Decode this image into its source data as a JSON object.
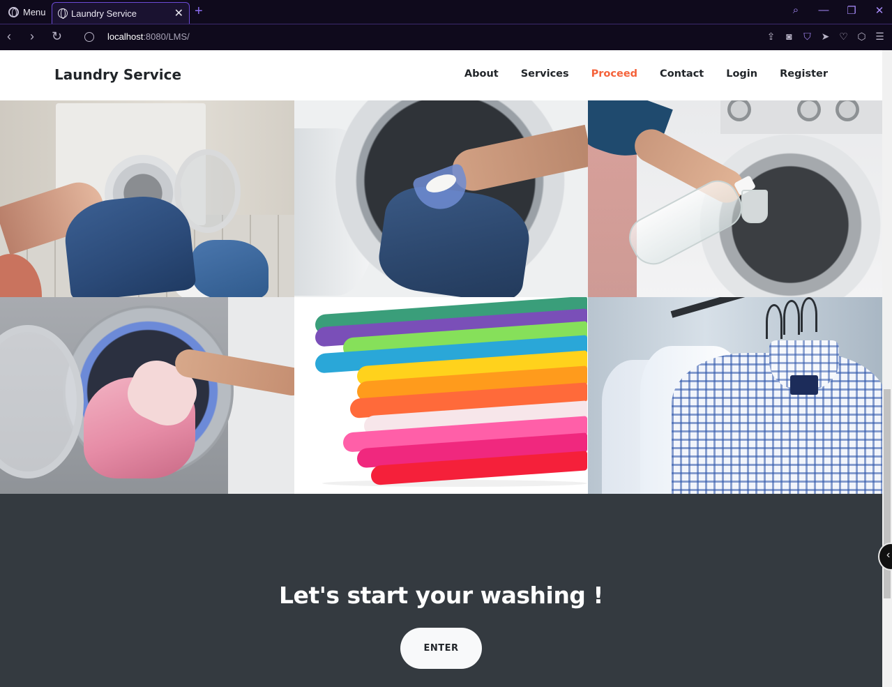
{
  "browser": {
    "menu_label": "Menu",
    "tab_title": "Laundry Service",
    "new_tab_symbol": "+",
    "url_host": "localhost",
    "url_rest": ":8080/LMS/",
    "icons": [
      "opera-logo-icon",
      "globe-icon",
      "close-icon",
      "back-icon",
      "forward-icon",
      "reload-icon",
      "site-info-icon",
      "share-icon",
      "camera-icon",
      "vpn-shield-icon",
      "send-icon",
      "heart-icon",
      "cube-icon",
      "easy-setup-icon",
      "search-icon",
      "minimize-icon",
      "restore-icon",
      "window-close-icon"
    ]
  },
  "navbar": {
    "brand": "Laundry Service",
    "links": [
      {
        "label": "About"
      },
      {
        "label": "Services"
      },
      {
        "label": "Proceed",
        "active": true
      },
      {
        "label": "Contact"
      },
      {
        "label": "Login"
      },
      {
        "label": "Register"
      }
    ]
  },
  "gallery": {
    "images": [
      "laundromat-hands-holding-blue-shirt",
      "washing-machine-jeans-detergent-scoop",
      "pouring-vinegar-into-washer",
      "pink-towel-into-drum",
      "folded-colorful-clothes",
      "checked-shirts-on-hangers"
    ]
  },
  "cta": {
    "title": "Let's start your washing !",
    "button_label": "ENTER"
  },
  "colors": {
    "accent": "#f4623a",
    "dark_section": "#343a40",
    "browser_bg": "#0f0a1c",
    "browser_accent": "#a78bfa"
  }
}
